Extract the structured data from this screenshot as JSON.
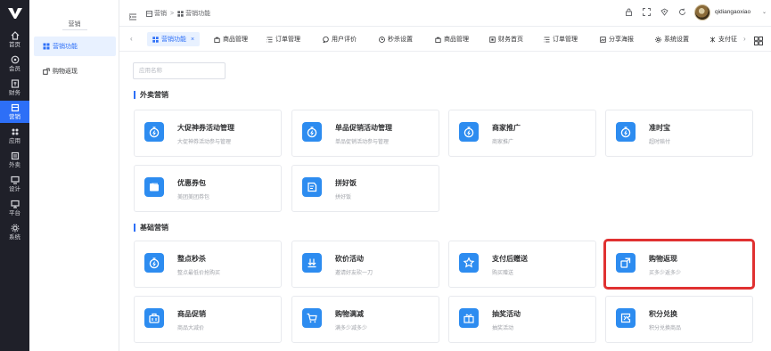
{
  "colors": {
    "accent": "#2d6ff7",
    "icon_bg": "#2d8cf0",
    "rail_bg": "#1f2029",
    "highlight": "#e03131"
  },
  "rail": {
    "items": [
      {
        "label": "首页",
        "icon": "home-icon"
      },
      {
        "label": "会员",
        "icon": "member-icon"
      },
      {
        "label": "财务",
        "icon": "finance-icon"
      },
      {
        "label": "营销",
        "icon": "marketing-icon",
        "active": true
      },
      {
        "label": "应用",
        "icon": "apps-icon"
      },
      {
        "label": "外卖",
        "icon": "takeout-icon"
      },
      {
        "label": "设计",
        "icon": "design-icon"
      },
      {
        "label": "平台",
        "icon": "platform-icon"
      },
      {
        "label": "系统",
        "icon": "settings-icon"
      }
    ]
  },
  "subnav": {
    "title": "营销",
    "items": [
      {
        "label": "营销功能",
        "icon": "grid-icon",
        "active": true
      },
      {
        "label": "购物返现",
        "icon": "cashback-icon"
      }
    ]
  },
  "header": {
    "breadcrumb": [
      "营销",
      "营销功能"
    ],
    "username": "qidiangaoxiao"
  },
  "tabs": [
    {
      "label": "营销功能",
      "icon": "grid-icon",
      "active": true,
      "closable": "×"
    },
    {
      "label": "商品管理",
      "icon": "bag-icon"
    },
    {
      "label": "订单管理",
      "icon": "order-icon"
    },
    {
      "label": "用户评价",
      "icon": "comment-icon"
    },
    {
      "label": "秒杀设置",
      "icon": "clock-icon"
    },
    {
      "label": "商品管理",
      "icon": "bag-icon"
    },
    {
      "label": "财务首页",
      "icon": "finance-icon"
    },
    {
      "label": "订单管理",
      "icon": "order-icon"
    },
    {
      "label": "分享海报",
      "icon": "poster-icon"
    },
    {
      "label": "系统设置",
      "icon": "gear-icon"
    },
    {
      "label": "支付征",
      "icon": "pay-icon"
    }
  ],
  "search": {
    "placeholder": "应用名称",
    "value": ""
  },
  "sections": [
    {
      "title": "外卖营销",
      "cards": [
        {
          "title": "大促神券活动管理",
          "desc": "大促神券活动参与管理",
          "icon": "stopwatch-icon"
        },
        {
          "title": "单品促销活动管理",
          "desc": "单品促销活动参与管理",
          "icon": "stopwatch-icon"
        },
        {
          "title": "商家推广",
          "desc": "商家推广",
          "icon": "stopwatch-icon"
        },
        {
          "title": "准时宝",
          "desc": "超时赔付",
          "icon": "stopwatch-icon"
        },
        {
          "title": "优惠券包",
          "desc": "美团美团券包",
          "icon": "coupon-folder-icon"
        },
        {
          "title": "拼好饭",
          "desc": "拼好饭",
          "icon": "shield-tag-icon"
        }
      ]
    },
    {
      "title": "基础营销",
      "cards": [
        {
          "title": "整点秒杀",
          "desc": "整点最低价抢购买",
          "icon": "stopwatch-icon"
        },
        {
          "title": "砍价活动",
          "desc": "邀请好友砍一刀",
          "icon": "bargain-icon"
        },
        {
          "title": "支付后赠送",
          "desc": "购买赠送",
          "icon": "gift-star-icon"
        },
        {
          "title": "购物返现",
          "desc": "买多少返多少",
          "icon": "cashback-icon",
          "highlight": true
        },
        {
          "title": "商品促销",
          "desc": "商品大减价",
          "icon": "promo-bag-icon"
        },
        {
          "title": "购物满减",
          "desc": "满多少减多少",
          "icon": "cart-icon"
        },
        {
          "title": "抽奖活动",
          "desc": "抽奖活动",
          "icon": "lottery-icon"
        },
        {
          "title": "积分兑换",
          "desc": "积分兑换商品",
          "icon": "points-icon"
        }
      ]
    }
  ]
}
